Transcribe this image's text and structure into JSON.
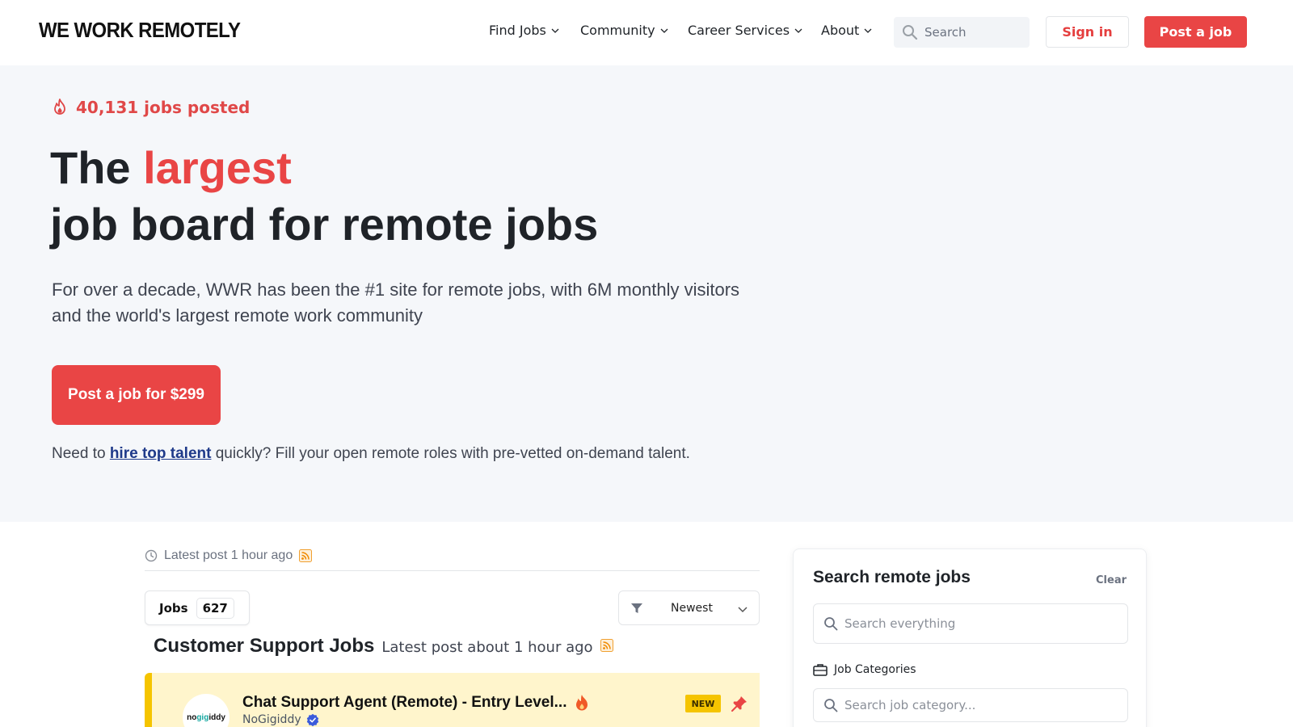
{
  "header": {
    "logo": "WE WORK REMOTELY",
    "nav": [
      {
        "label": "Find Jobs"
      },
      {
        "label": "Community"
      },
      {
        "label": "Career Services"
      },
      {
        "label": "About"
      }
    ],
    "search_placeholder": "Search",
    "sign_in": "Sign in",
    "post_job": "Post a job"
  },
  "hero": {
    "jobs_posted": "40,131 jobs posted",
    "title_pre": "The ",
    "title_accent": "largest",
    "title_line2": "job board for remote jobs",
    "subtitle": "For over a decade, WWR has been the #1 site for remote jobs, with 6M monthly visitors and the world's largest remote work community",
    "cta": "Post a job for $299",
    "hire_pre": "Need to ",
    "hire_link": "hire top talent",
    "hire_post": " quickly? Fill your open remote roles with pre-vetted on-demand talent."
  },
  "listing": {
    "latest_post": "Latest post 1 hour ago",
    "jobs_tab_label": "Jobs",
    "jobs_count": "627",
    "sort_label": "Newest",
    "category_title": "Customer Support Jobs",
    "category_latest": "Latest post about 1 hour ago",
    "job": {
      "logo_text_a": "no",
      "logo_text_b": "gig",
      "logo_text_c": "iddy",
      "title": "Chat Support Agent (Remote) - Entry Level...",
      "company": "NoGigiddy",
      "badge": "NEW"
    }
  },
  "sidebar": {
    "title": "Search remote jobs",
    "clear": "Clear",
    "search_placeholder": "Search everything",
    "categories_label": "Job Categories",
    "category_placeholder": "Search job category..."
  },
  "colors": {
    "accent": "#e94545",
    "hero_bg": "#f5f7fa",
    "featured_bg": "#fff5cc",
    "featured_border": "#f5c400",
    "link": "#1f3a8a"
  }
}
